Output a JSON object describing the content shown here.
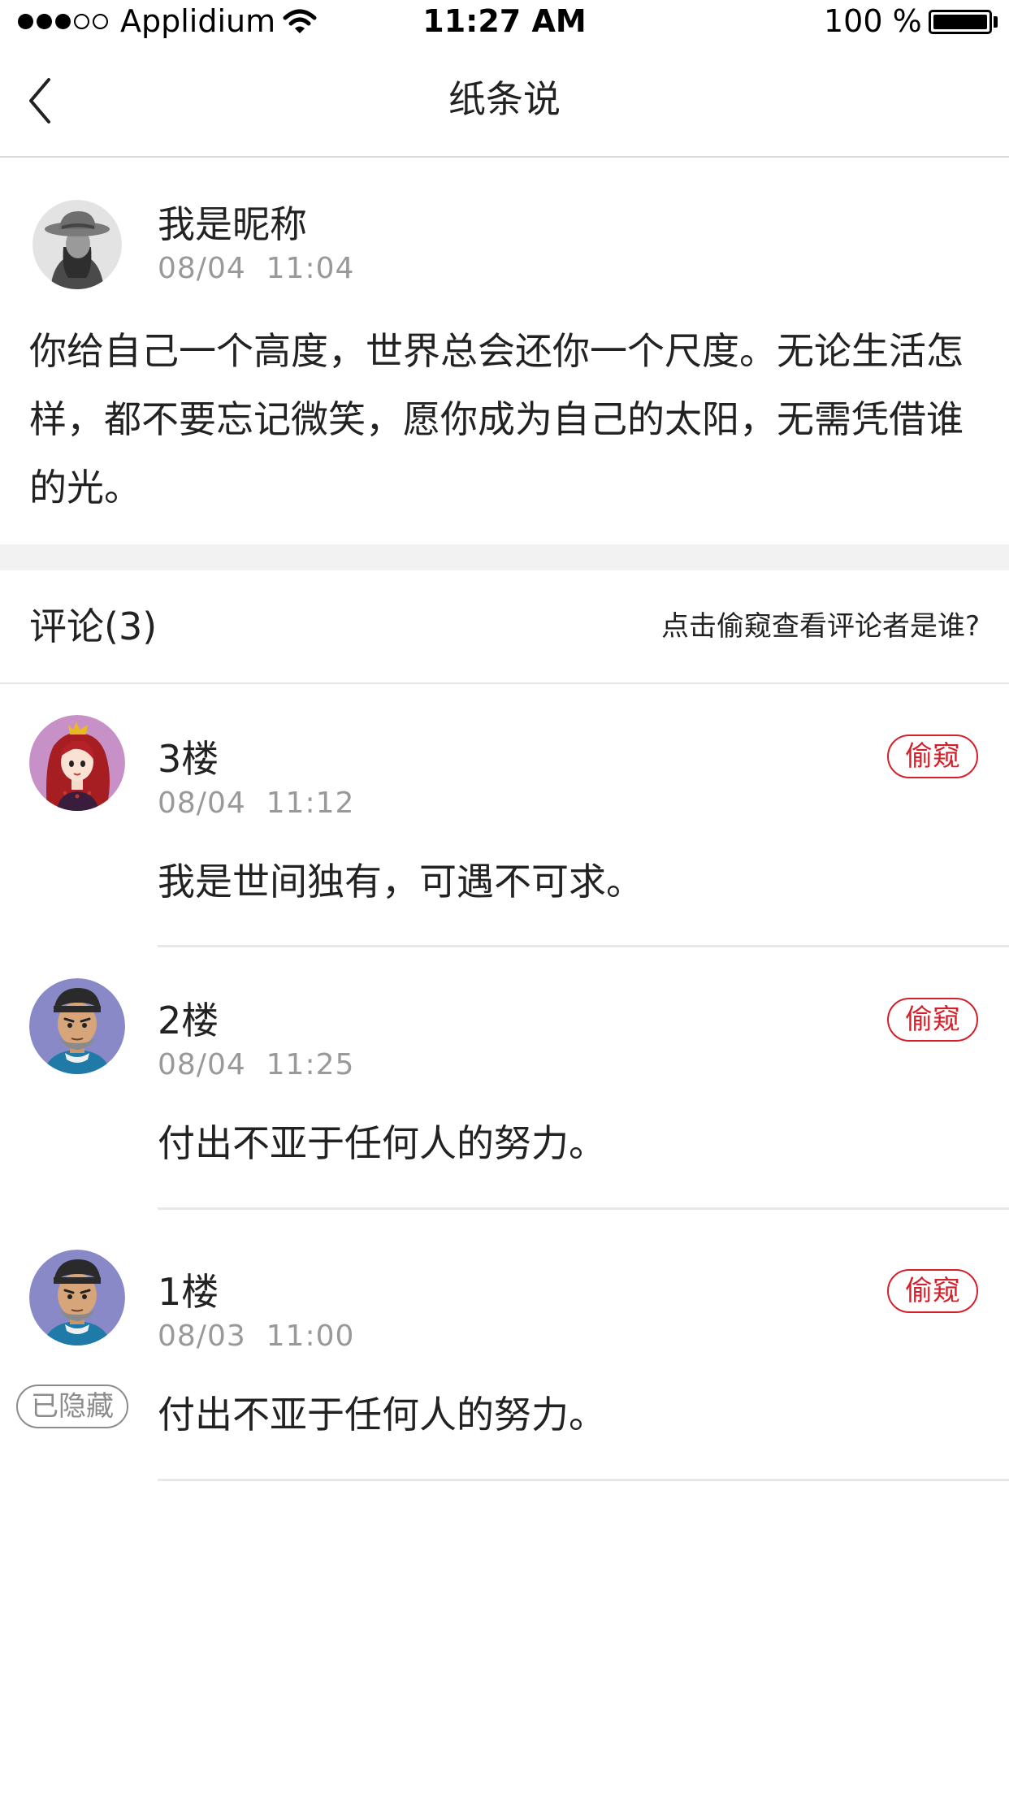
{
  "status_bar": {
    "carrier": "Applidium",
    "time": "11:27 AM",
    "battery": "100 %",
    "signal_bars": 3,
    "signal_total": 5
  },
  "nav": {
    "title": "纸条说",
    "back_icon": "chevron-left-icon"
  },
  "post": {
    "author": "我是昵称",
    "date": "08/04",
    "time": "11:04",
    "content": "你给自己一个高度，世界总会还你一个尺度。无论生活怎样，都不要忘记微笑，愿你成为自己的太阳，无需凭借谁的光。"
  },
  "comments_section": {
    "title": "评论(3)",
    "hint": "点击偷窥查看评论者是谁?"
  },
  "comments": [
    {
      "floor": "3楼",
      "date": "08/04",
      "time": "11:12",
      "text": "我是世间独有，可遇不可求。",
      "action": "偷窥",
      "avatar": "queen-avatar"
    },
    {
      "floor": "2楼",
      "date": "08/04",
      "time": "11:25",
      "text": "付出不亚于任何人的努力。",
      "action": "偷窥",
      "avatar": "man-avatar"
    },
    {
      "floor": "1楼",
      "date": "08/03",
      "time": "11:00",
      "text": "付出不亚于任何人的努力。",
      "action": "偷窥",
      "avatar": "man-avatar",
      "badge": "已隐藏"
    }
  ],
  "colors": {
    "accent": "#d51f2a",
    "muted": "#999999",
    "text": "#222222",
    "section_gap": "#f2f2f2"
  }
}
